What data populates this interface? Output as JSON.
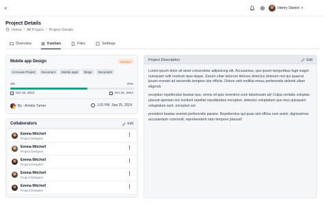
{
  "topbar": {
    "collapse_icon": "«",
    "icons": [
      "bell-icon",
      "gear-icon"
    ],
    "user_name": "Henry Daniel"
  },
  "page": {
    "title": "Project Details",
    "breadcrumb": [
      "Home",
      "All Project",
      "Project Details"
    ]
  },
  "tabs": [
    {
      "label": "Overview",
      "icon": "overview-icon",
      "active": false
    },
    {
      "label": "Kanban",
      "icon": "kanban-icon",
      "active": true
    },
    {
      "label": "Files",
      "icon": "file-icon",
      "active": false
    },
    {
      "label": "Settings",
      "icon": "settings-icon",
      "active": false
    }
  ],
  "task": {
    "title": "Mobile app Design",
    "priority": "Medium",
    "tags": [
      "In-House Project",
      "Document",
      "Mobile apps",
      "Blogs",
      "Document"
    ],
    "progress_label": "3/6",
    "progress_percent": "70%",
    "progress_fraction": 0.62,
    "start_date": "Oct 16, 2024",
    "end_date": "Oct 16, 2024",
    "author": "By  - Amelia Turner",
    "time": "1:01 PM,  Sep 25, 2024"
  },
  "collaborators": {
    "title": "Collaborators",
    "edit_label": "Edit",
    "items": [
      {
        "name": "Emma Mitchell",
        "role": "Project Designer"
      },
      {
        "name": "Emma Mitchell",
        "role": "Project Designer"
      },
      {
        "name": "Emma Mitchell",
        "role": "Project Designer"
      },
      {
        "name": "Emma Mitchell",
        "role": "Project Designer"
      },
      {
        "name": "Emma Mitchell",
        "role": "Project Designer"
      }
    ]
  },
  "description": {
    "title": "Project Description",
    "edit_label": "Edit",
    "paragraphs": [
      "Lorem ipsum dolor sit amet consectetur adipisicing elit. Accusamus, quo ipsum temporibus fugit magni numquam velit nostrum ipsa itaque. Earum vitae dolorum dolores delectus dolorum nisi qui quaerat ipsum eveniet ad reiciendis tempore iste officiis. Dolore velit mollitia minus perferendis deleniti ullam eligendi.",
      "excepturi repellendus beatae quo, omnis sit quis inventore eum laboriosam ab! Culpa veritatis voluptas placeat aperiam nisi incidunt repellat repudiandae excepturi, delectus voluptatum quo eius quisquam voluptatum sunt, excepturi est",
      "provident beatae eveniet perferendis paratur. Repellendus qui quae sint officia cum animi, dignissimos accusantium commodi, reprehenderit nam tempore placeat!"
    ]
  }
}
